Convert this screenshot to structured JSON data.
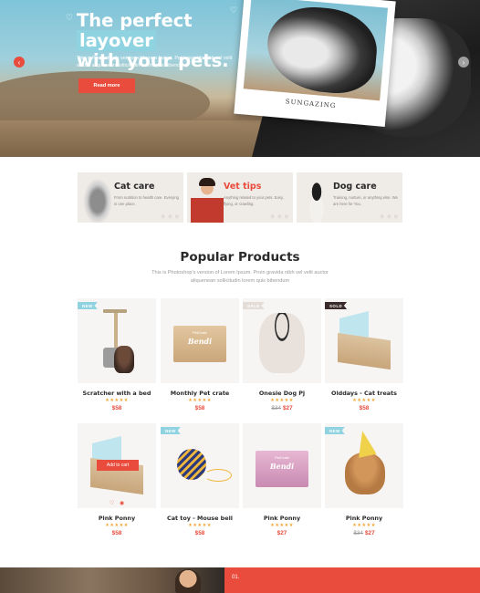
{
  "hero": {
    "title_line1_a": "The perfect",
    "title_line1_b": "layover",
    "title_line2": "with your pets.",
    "subtitle": "This is Photoshop's version  of Lorem Ipsum. Proin gravida nibh vel velit auctor aliquenean sollicitudin lorem quis bibendum",
    "button": "Read more",
    "polaroid_caption": "SUNGAZING",
    "arrow_left": "‹",
    "arrow_right": "›"
  },
  "categories": [
    {
      "title": "Cat care",
      "desc": "From nutrition to health care. Everying in one place."
    },
    {
      "title": "Vet tips",
      "desc": "Anything related to your pets. Easy, flying, or crawling."
    },
    {
      "title": "Dog care",
      "desc": "Training, nurture, or anything else. We are here for You."
    }
  ],
  "products_section": {
    "title": "Popular Products",
    "subtitle": "This is Photoshop's version  of Lorem Ipsum. Proin gravida nibh vel velit auctor aliquenean sollicitudin lorem quis bibendum"
  },
  "products": [
    {
      "badge": "NEW",
      "name": "Scratcher with a bed",
      "stars": "★★★★★",
      "old_price": "",
      "price": "$58"
    },
    {
      "badge": "",
      "name": "Monthly Pet crate",
      "stars": "★★★★★",
      "old_price": "",
      "price": "$58",
      "box_label": "Bendi",
      "box_brand": "PetCrate"
    },
    {
      "badge": "SALE",
      "name": "Onesie Dog Pj",
      "stars": "★★★★★",
      "old_price": "$34",
      "price": "$27"
    },
    {
      "badge": "SOLD",
      "name": "Olddays - Cat treats",
      "stars": "★★★★★",
      "old_price": "",
      "price": "$58"
    },
    {
      "badge": "",
      "name": "Pink Ponny",
      "stars": "★★★★★",
      "old_price": "",
      "price": "$58",
      "add_to_cart": "Add to cart",
      "heart": "♡",
      "eye": "◉"
    },
    {
      "badge": "NEW",
      "name": "Cat toy - Mouse bell",
      "stars": "★★★★★",
      "old_price": "",
      "price": "$58"
    },
    {
      "badge": "",
      "name": "Pink Ponny",
      "stars": "★★★★★",
      "old_price": "",
      "price": "$27",
      "box_label": "Bendi",
      "box_brand": "PetCrate"
    },
    {
      "badge": "NEW",
      "name": "Pink Ponny",
      "stars": "★★★★★",
      "old_price": "$34",
      "price": "$27"
    }
  ],
  "bottom": {
    "number": "01."
  },
  "colors": {
    "accent": "#e94b3c",
    "highlight": "#8fd3e0",
    "card_bg": "#efebe7",
    "star": "#f2a93b"
  }
}
